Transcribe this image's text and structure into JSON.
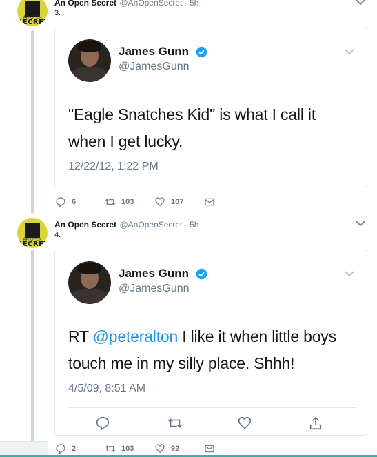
{
  "tweets": [
    {
      "author_name": "An Open Secret",
      "author_handle": "@AnOpenSecret",
      "time": "5h",
      "number": "3.",
      "avatar_text_top": "AN OPEN",
      "avatar_text_bottom": "SECRET",
      "quoted": {
        "name": "James Gunn",
        "handle": "@JamesGunn",
        "text": "\"Eagle Snatches Kid\" is what I call it when I get lucky.",
        "date": "12/22/12, 1:22 PM"
      },
      "replies": "6",
      "retweets": "103",
      "likes": "107"
    },
    {
      "author_name": "An Open Secret",
      "author_handle": "@AnOpenSecret",
      "time": "5h",
      "number": "4.",
      "avatar_text_top": "AN OPEN",
      "avatar_text_bottom": "SECRET",
      "quoted": {
        "name": "James Gunn",
        "handle": "@JamesGunn",
        "text_prefix": "RT ",
        "text_mention": "@peteralton",
        "text_rest": " I like it when little boys touch me in my silly place.  Shhh!",
        "date": "4/5/09, 8:51 AM"
      },
      "replies": "2",
      "retweets": "103",
      "likes": "92"
    }
  ],
  "separator": " · ",
  "colors": {
    "link": "#1b95e0",
    "muted": "#657786",
    "verified": "#1da1f2",
    "avatar_bg": "#d8d53a"
  }
}
